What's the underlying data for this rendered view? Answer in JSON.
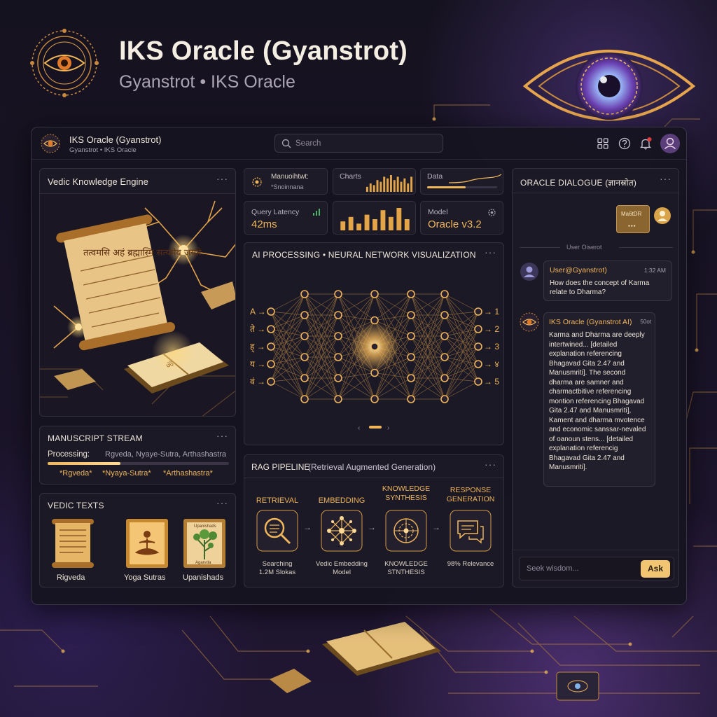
{
  "hero": {
    "title": "IKS Oracle (Gyanstrot)",
    "subtitle": "Gyanstrot • IKS Oracle"
  },
  "app": {
    "title": "IKS Oracle (Gyanstrot)",
    "subtitle": "Gyanstrot • IKS Oracle",
    "search_placeholder": "Search"
  },
  "toolbar": {
    "icons": [
      "grid-icon",
      "help-icon",
      "bell-icon",
      "user-icon"
    ]
  },
  "colors": {
    "accent_gold": "#f0b65a",
    "panel_bg": "#1c1926",
    "window_bg": "#16141f",
    "notification": "#e23b3b"
  },
  "engine": {
    "title": "Vedic Knowledge Engine",
    "scroll_text": "तत्वमसि अहं ब्रह्मास्मि सत्यमेव जयते",
    "book_text": "ॐ"
  },
  "stream": {
    "title": "MANUSCRIPT STREAM",
    "processing_label": "Processing:",
    "processing_items": "Rgveda,  Nyaye-Sutra,  Arthashastra",
    "progress": 0.4,
    "tags": [
      "*Rgveda*",
      "*Nyaya-Sutra*",
      "*Arthashastra*"
    ]
  },
  "texts": {
    "title": "VEDIC TEXTS",
    "items": [
      {
        "label": "Rigveda",
        "icon": "scroll-icon"
      },
      {
        "label": "Yoga Sutras",
        "icon": "meditation-icon"
      },
      {
        "label": "Upanishads",
        "icon": "tree-icon",
        "art_caption": "Upanishads",
        "art_caption2": "Agarvda"
      }
    ]
  },
  "stats": {
    "manuscripts": {
      "label": "Manuoihtwt:",
      "value": "*Snoinnana"
    },
    "charts": {
      "label": "Charts",
      "bars": [
        0.3,
        0.5,
        0.4,
        0.7,
        0.6,
        0.9,
        0.8,
        1.0,
        0.7,
        0.9,
        0.6,
        0.8,
        0.5,
        0.9
      ]
    },
    "data": {
      "label": "Data",
      "progress": 0.55
    },
    "latency": {
      "label": "Query Latency",
      "value": "42ms"
    },
    "bars2": [
      0.4,
      0.6,
      0.3,
      0.7,
      0.5,
      0.9,
      0.6,
      1.0,
      0.5
    ],
    "model": {
      "label": "Model",
      "value": "Oracle v3.2"
    }
  },
  "neural": {
    "title": "AI PROCESSING • NEURAL NETWORK VISUALIZATION",
    "inputs": [
      "A",
      "ते",
      "ह्",
      "य",
      "वं"
    ],
    "outputs": [
      "1",
      "2",
      "3",
      "४",
      "5"
    ]
  },
  "rag": {
    "title": "RAG PIPELINE",
    "title_sub": "(Retrieval Augmented Generation)",
    "steps": [
      {
        "title": "RETRIEVAL",
        "caption": "Searching\n1.2M Slokas",
        "icon": "magnifier-icon"
      },
      {
        "title": "EMBEDDING",
        "caption": "Vedic Embedding\nModel",
        "icon": "network-icon"
      },
      {
        "title": "KNOWLEDGE\nSYNTHESIS",
        "caption": "KNOWLEDGE\nSTNTHESIS",
        "icon": "brain-icon"
      },
      {
        "title": "RESPONSE\nGENERATION",
        "caption": "98% Relevance",
        "icon": "chat-icon"
      }
    ]
  },
  "dialogue": {
    "title": "ORACLE DIALOGUE (ज्ञानस्रोत)",
    "card_label": "Ma6tDR",
    "divider": "User Oiserot",
    "user": {
      "name": "User@Gyanstrot)",
      "time": "1:32 AM",
      "message": "How does the concept of Karma relate to Dharma?"
    },
    "ai": {
      "name": "IKS Oracle (Gyanstrot AI)",
      "time": "50ot",
      "message": "Karma and Dharma are deeply intertwined... [detailed explanation referencing Bhagavad Gita 2.47 and Manusmriti]. The second dharma are samner and charmactbitive referencing montion referencing Bhagavad Gita 2.47 and Manusmriti], Kament and dharma mvotence and economic sanssar-nevaled of oanoun stens... [detailed explanation referencig Bhagavad Gita 2.47 and Manusmriti]."
    },
    "input_placeholder": "Seek wisdom...",
    "ask_label": "Ask"
  }
}
